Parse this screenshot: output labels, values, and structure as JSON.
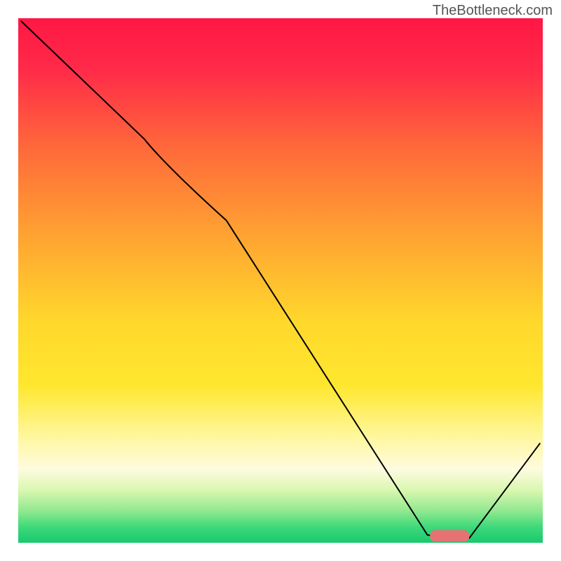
{
  "watermark": "TheBottleneck.com",
  "chart_data": {
    "type": "line",
    "title": "",
    "xlabel": "",
    "ylabel": "",
    "xlim": [
      0,
      100
    ],
    "ylim": [
      0,
      100
    ],
    "background_gradient": {
      "stops": [
        {
          "offset": 0,
          "color": "#ff1744"
        },
        {
          "offset": 10,
          "color": "#ff2b48"
        },
        {
          "offset": 25,
          "color": "#ff6a3a"
        },
        {
          "offset": 42,
          "color": "#ffa531"
        },
        {
          "offset": 58,
          "color": "#ffd82c"
        },
        {
          "offset": 70,
          "color": "#ffe72e"
        },
        {
          "offset": 80,
          "color": "#fff7a0"
        },
        {
          "offset": 86,
          "color": "#fffbe0"
        },
        {
          "offset": 90,
          "color": "#d9f7b0"
        },
        {
          "offset": 94,
          "color": "#8fe88f"
        },
        {
          "offset": 97,
          "color": "#3dd97a"
        },
        {
          "offset": 100,
          "color": "#19c96e"
        }
      ]
    },
    "series": [
      {
        "name": "curve",
        "color": "#000000",
        "points": [
          {
            "x": 0.5,
            "y": 99.5
          },
          {
            "x": 24,
            "y": 77
          },
          {
            "x": 28,
            "y": 72
          },
          {
            "x": 78,
            "y": 1.5
          },
          {
            "x": 86,
            "y": 0.9
          },
          {
            "x": 99.5,
            "y": 19
          }
        ]
      }
    ],
    "marker": {
      "name": "target-range",
      "color": "#e57373",
      "x_start": 78.5,
      "x_end": 86,
      "y": 1.3,
      "thickness": 2.2
    }
  }
}
